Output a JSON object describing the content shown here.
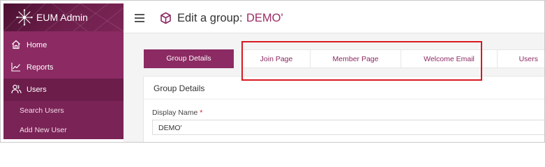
{
  "app": {
    "name": "EUM Admin"
  },
  "sidebar": {
    "items": [
      {
        "label": "Home",
        "icon": "home-icon"
      },
      {
        "label": "Reports",
        "icon": "chart-line-icon"
      },
      {
        "label": "Users",
        "icon": "users-icon"
      }
    ],
    "sub_items": [
      {
        "label": "Search Users"
      },
      {
        "label": "Add New User"
      }
    ]
  },
  "header": {
    "title_prefix": "Edit a group:",
    "group_name": "DEMO'"
  },
  "tabs": [
    {
      "label": "Group Details"
    },
    {
      "label": "Join Page"
    },
    {
      "label": "Member Page"
    },
    {
      "label": "Welcome Email"
    },
    {
      "label": "Users"
    }
  ],
  "card": {
    "title": "Group Details",
    "display_name": {
      "label": "Display Name",
      "required_marker": "*",
      "value": "DEMO'"
    }
  },
  "colors": {
    "brand": "#8b2a63",
    "highlight": "#d71920"
  }
}
